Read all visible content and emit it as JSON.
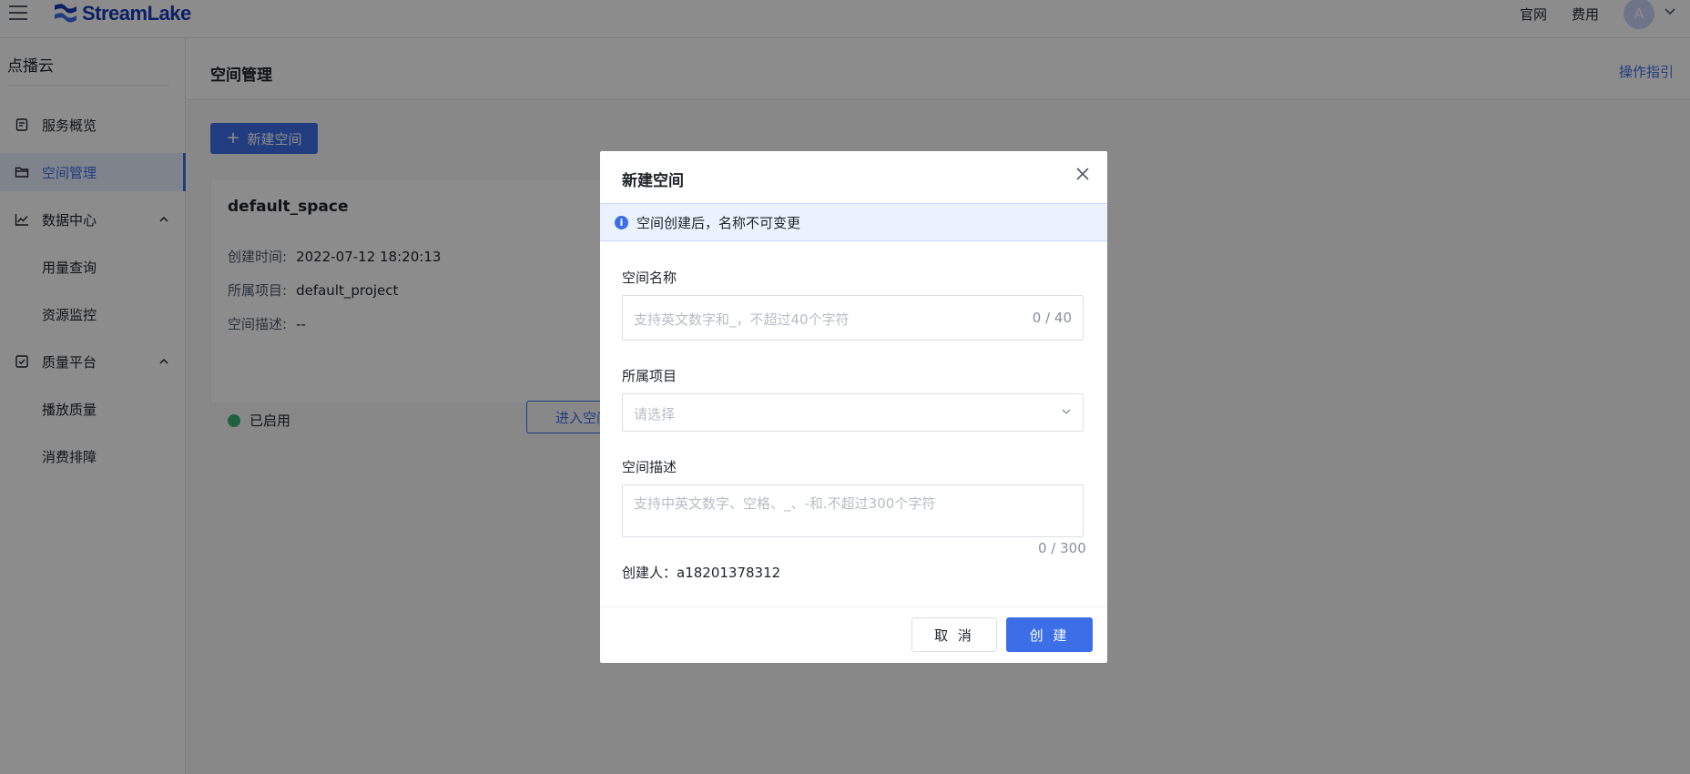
{
  "topbar": {
    "brand": "StreamLake",
    "links": [
      "官网",
      "费用"
    ],
    "avatar_initial": "A"
  },
  "sidebar": {
    "title": "点播云",
    "items": [
      {
        "label": "服务概览",
        "icon": "doc-icon"
      },
      {
        "label": "空间管理",
        "icon": "folder-icon",
        "active": true
      },
      {
        "label": "数据中心",
        "icon": "chart-icon",
        "expanded": true
      },
      {
        "label": "用量查询"
      },
      {
        "label": "资源监控"
      },
      {
        "label": "质量平台",
        "icon": "checkbox-icon",
        "expanded": true
      },
      {
        "label": "播放质量"
      },
      {
        "label": "消费排障"
      }
    ]
  },
  "main": {
    "title": "空间管理",
    "guide_link": "操作指引",
    "new_button": "新建空间",
    "card": {
      "name": "default_space",
      "rows": [
        {
          "label": "创建时间:",
          "value": "2022-07-12 18:20:13"
        },
        {
          "label": "所属项目:",
          "value": "default_project"
        },
        {
          "label": "空间描述:",
          "value": "--"
        }
      ],
      "status": "已启用",
      "enter_button": "进入空间"
    }
  },
  "modal": {
    "title": "新建空间",
    "notice": "空间创建后，名称不可变更",
    "name_field": {
      "label": "空间名称",
      "placeholder": "支持英文数字和_，不超过40个字符",
      "counter": "0 / 40"
    },
    "project_field": {
      "label": "所属项目",
      "placeholder": "请选择"
    },
    "desc_field": {
      "label": "空间描述",
      "placeholder": "支持中英文数字、空格、_、-和.不超过300个字符",
      "counter": "0 / 300"
    },
    "creator": "创建人：a18201378312",
    "cancel_button": "取 消",
    "ok_button": "创 建"
  },
  "colors": {
    "accent": "#3c6ee8",
    "status_ok": "#3cb371",
    "brand": "#1a3bb8"
  }
}
